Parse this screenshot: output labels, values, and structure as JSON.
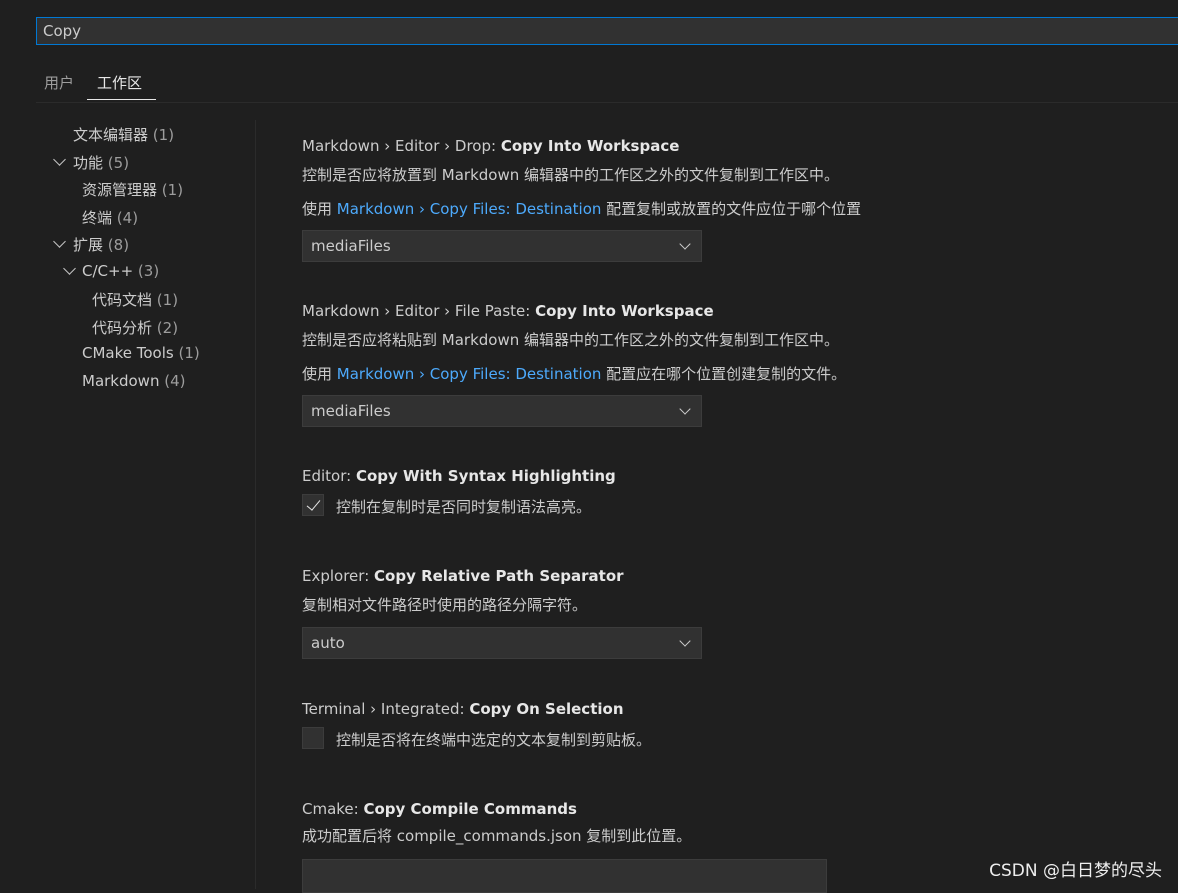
{
  "search": {
    "value": "Copy"
  },
  "tabs": [
    {
      "label": "用户"
    },
    {
      "label": "工作区"
    }
  ],
  "toc": [
    {
      "label": "文本编辑器",
      "count": "(1)"
    },
    {
      "label": "功能",
      "count": "(5)"
    },
    {
      "label": "资源管理器",
      "count": "(1)"
    },
    {
      "label": "终端",
      "count": "(4)"
    },
    {
      "label": "扩展",
      "count": "(8)"
    },
    {
      "label": "C/C++",
      "count": "(3)"
    },
    {
      "label": "代码文档",
      "count": "(1)"
    },
    {
      "label": "代码分析",
      "count": "(2)"
    },
    {
      "label": "CMake Tools",
      "count": "(1)"
    },
    {
      "label": "Markdown",
      "count": "(4)"
    }
  ],
  "settings": [
    {
      "category": "Markdown › Editor › Drop: ",
      "name": "Copy Into Workspace",
      "description": "控制是否应将放置到 Markdown 编辑器中的工作区之外的文件复制到工作区中。",
      "desc_prefix": "使用 ",
      "desc_link": "Markdown › Copy Files: Destination",
      "desc_suffix": " 配置复制或放置的文件应位于哪个位置",
      "value": "mediaFiles"
    },
    {
      "category": "Markdown › Editor › File Paste: ",
      "name": "Copy Into Workspace",
      "description": "控制是否应将粘贴到 Markdown 编辑器中的工作区之外的文件复制到工作区中。",
      "desc_prefix": "使用 ",
      "desc_link": "Markdown › Copy Files: Destination",
      "desc_suffix": " 配置应在哪个位置创建复制的文件。",
      "value": "mediaFiles"
    },
    {
      "category": "Editor: ",
      "name": "Copy With Syntax Highlighting",
      "description": "控制在复制时是否同时复制语法高亮。",
      "checked": true
    },
    {
      "category": "Explorer: ",
      "name": "Copy Relative Path Separator",
      "description": "复制相对文件路径时使用的路径分隔字符。",
      "value": "auto"
    },
    {
      "category": "Terminal › Integrated: ",
      "name": "Copy On Selection",
      "description": "控制是否将在终端中选定的文本复制到剪贴板。",
      "checked": false
    },
    {
      "category": "Cmake: ",
      "name": "Copy Compile Commands",
      "description": "成功配置后将 compile_commands.json 复制到此位置。",
      "value": ""
    }
  ],
  "watermark": "CSDN @白日梦的尽头"
}
